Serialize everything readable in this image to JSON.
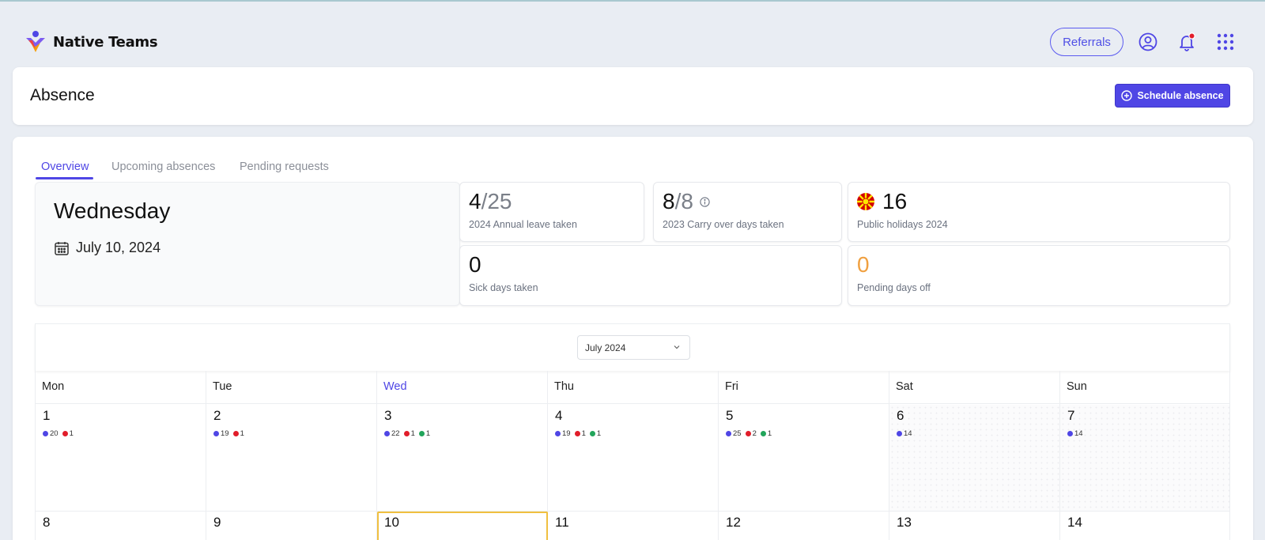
{
  "app": {
    "name": "Native Teams",
    "referrals_label": "Referrals",
    "notification_dot_color": "#e11d2a"
  },
  "page": {
    "title": "Absence",
    "schedule_button": "Schedule absence"
  },
  "tabs": [
    {
      "label": "Overview",
      "active": true
    },
    {
      "label": "Upcoming absences",
      "active": false
    },
    {
      "label": "Pending requests",
      "active": false
    }
  ],
  "today": {
    "weekday": "Wednesday",
    "date": "July 10, 2024"
  },
  "stats": {
    "annual": {
      "value": "4",
      "total": "/25",
      "label": "2024 Annual leave taken"
    },
    "carry": {
      "value": "8",
      "total": "/8",
      "label": "2023 Carry over days taken"
    },
    "holidays": {
      "value": "16",
      "label": "Public holidays 2024"
    },
    "sick": {
      "value": "0",
      "label": "Sick days taken"
    },
    "pending": {
      "value": "0",
      "label": "Pending days off",
      "color": "#f59e0b"
    }
  },
  "calendar": {
    "month_label": "July 2024",
    "weekdays": [
      "Mon",
      "Tue",
      "Wed",
      "Thu",
      "Fri",
      "Sat",
      "Sun"
    ],
    "today_weekday_index": 2,
    "colors": {
      "blue": "#4f46e5",
      "red": "#e11d2a",
      "green": "#22a55b"
    },
    "week1": [
      {
        "day": "1",
        "badges": [
          {
            "color": "blue",
            "count": "20"
          },
          {
            "color": "red",
            "count": "1"
          }
        ]
      },
      {
        "day": "2",
        "badges": [
          {
            "color": "blue",
            "count": "19"
          },
          {
            "color": "red",
            "count": "1"
          }
        ]
      },
      {
        "day": "3",
        "badges": [
          {
            "color": "blue",
            "count": "22"
          },
          {
            "color": "red",
            "count": "1"
          },
          {
            "color": "green",
            "count": "1"
          }
        ]
      },
      {
        "day": "4",
        "badges": [
          {
            "color": "blue",
            "count": "19"
          },
          {
            "color": "red",
            "count": "1"
          },
          {
            "color": "green",
            "count": "1"
          }
        ]
      },
      {
        "day": "5",
        "badges": [
          {
            "color": "blue",
            "count": "25"
          },
          {
            "color": "red",
            "count": "2"
          },
          {
            "color": "green",
            "count": "1"
          }
        ]
      },
      {
        "day": "6",
        "badges": [
          {
            "color": "blue",
            "count": "14"
          }
        ]
      },
      {
        "day": "7",
        "badges": [
          {
            "color": "blue",
            "count": "14"
          }
        ]
      }
    ],
    "week2": [
      {
        "day": "8"
      },
      {
        "day": "9"
      },
      {
        "day": "10"
      },
      {
        "day": "11"
      },
      {
        "day": "12"
      },
      {
        "day": "13"
      },
      {
        "day": "14"
      }
    ]
  }
}
